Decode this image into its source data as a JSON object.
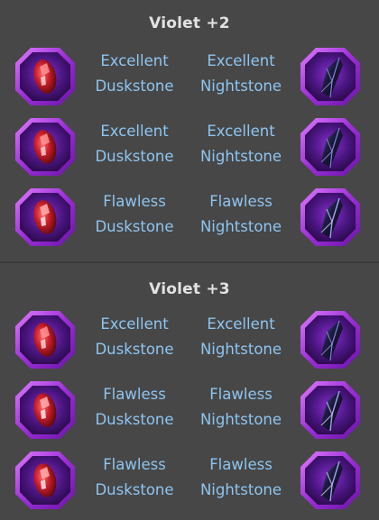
{
  "sections": [
    {
      "title": "Violet +2",
      "rows": [
        {
          "left_quality": "Excellent",
          "left_name": "Duskstone",
          "right_quality": "Excellent",
          "right_name": "Nightstone"
        },
        {
          "left_quality": "Excellent",
          "left_name": "Duskstone",
          "right_quality": "Excellent",
          "right_name": "Nightstone"
        },
        {
          "left_quality": "Flawless",
          "left_name": "Duskstone",
          "right_quality": "Flawless",
          "right_name": "Nightstone"
        }
      ]
    },
    {
      "title": "Violet +3",
      "rows": [
        {
          "left_quality": "Excellent",
          "left_name": "Duskstone",
          "right_quality": "Excellent",
          "right_name": "Nightstone"
        },
        {
          "left_quality": "Flawless",
          "left_name": "Duskstone",
          "right_quality": "Flawless",
          "right_name": "Nightstone"
        },
        {
          "left_quality": "Flawless",
          "left_name": "Duskstone",
          "right_quality": "Flawless",
          "right_name": "Nightstone"
        }
      ]
    }
  ],
  "icons": {
    "left": "duskstone-gem-icon",
    "right": "nightstone-gem-icon"
  },
  "colors": {
    "background": "#474747",
    "title": "#e2e2e2",
    "label": "#8ec5f0",
    "frame": "#9b2fd6",
    "duskstone": "#c8202a",
    "nightstone": "#2a2460"
  }
}
